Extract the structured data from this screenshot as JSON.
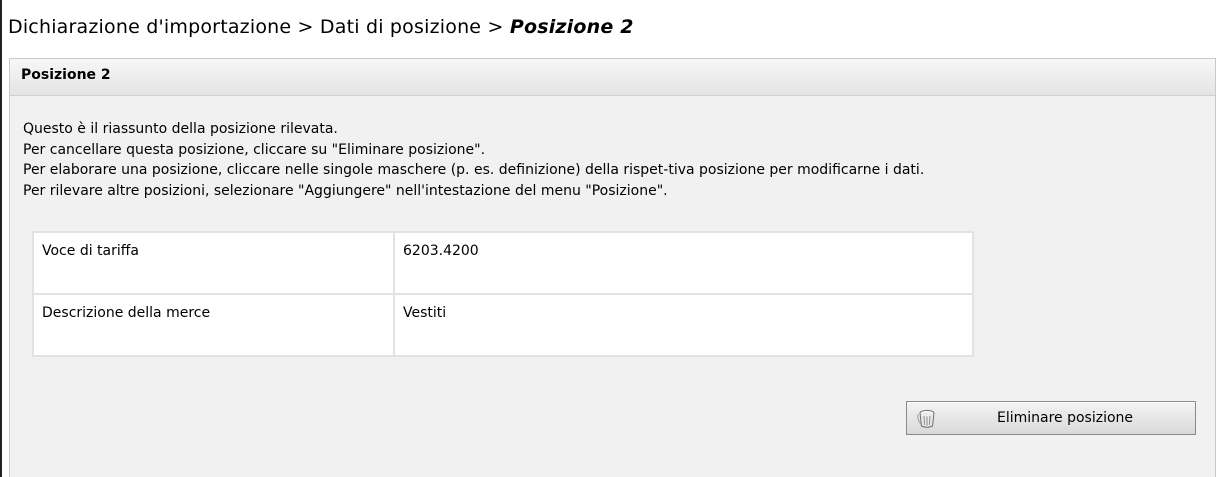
{
  "breadcrumb": {
    "part1": "Dichiarazione d'importazione",
    "sep1": " > ",
    "part2": "Dati di posizione",
    "sep2": " > ",
    "current": "Posizione 2"
  },
  "panel": {
    "title": "Posizione 2",
    "intro_lines": [
      "Questo è il riassunto della posizione rilevata.",
      "Per cancellare questa posizione, cliccare su \"Eliminare posizione\".",
      "Per elaborare una posizione, cliccare nelle singole maschere (p. es. definizione) della rispet-tiva posizione per modificarne i dati.",
      "Per rilevare altre posizioni, selezionare \"Aggiungere\" nell'intestazione del menu \"Posizione\"."
    ],
    "rows": [
      {
        "label": "Voce di tariffa",
        "value": "6203.4200"
      },
      {
        "label": "Descrizione della merce",
        "value": "Vestiti"
      }
    ],
    "delete_button": {
      "label": "Eliminare posizione",
      "icon": "trash-icon"
    }
  }
}
